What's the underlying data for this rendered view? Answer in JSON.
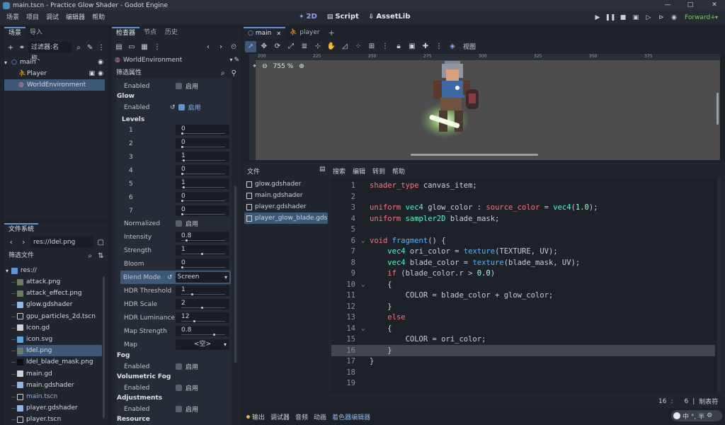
{
  "window": {
    "title": "main.tscn - Practice Glow Shader - Godot Engine",
    "minimize": "—",
    "maximize": "□",
    "close": "✕"
  },
  "menu": [
    "场景",
    "项目",
    "调试",
    "编辑器",
    "帮助"
  ],
  "workspaces": {
    "two_d": "2D",
    "script": "Script",
    "assetlib": "AssetLib"
  },
  "renderer": "Forward+",
  "scene_panel": {
    "tabs": [
      "场景",
      "导入"
    ],
    "filter_placeholder": "过滤器:名称、",
    "nodes": [
      {
        "label": "main",
        "level": 0
      },
      {
        "label": "Player",
        "level": 1
      },
      {
        "label": "WorldEnvironment",
        "level": 1,
        "selected": true
      }
    ]
  },
  "filesystem": {
    "title": "文件系统",
    "path": "res://Idel.png",
    "filter_placeholder": "筛选文件",
    "root": "res://",
    "files": [
      {
        "name": "attack.png",
        "icon": "image"
      },
      {
        "name": "attack_effect.png",
        "icon": "image"
      },
      {
        "name": "glow.gdshader",
        "icon": "shader"
      },
      {
        "name": "gpu_particles_2d.tscn",
        "icon": "scene"
      },
      {
        "name": "Icon.gd",
        "icon": "gear"
      },
      {
        "name": "icon.svg",
        "icon": "svg"
      },
      {
        "name": "Idel.png",
        "icon": "image",
        "selected": true
      },
      {
        "name": "Idel_blade_mask.png",
        "icon": "mask"
      },
      {
        "name": "main.gd",
        "icon": "gear"
      },
      {
        "name": "main.gdshader",
        "icon": "shader"
      },
      {
        "name": "main.tscn",
        "icon": "scene",
        "highlight": true
      },
      {
        "name": "player.gdshader",
        "icon": "shader"
      },
      {
        "name": "player.tscn",
        "icon": "scene"
      }
    ]
  },
  "inspector": {
    "tabs": [
      "检查器",
      "节点",
      "历史"
    ],
    "object": "WorldEnvironment",
    "filter_placeholder": "筛选属性",
    "enabled_label": "Enabled",
    "on_text": "启用",
    "glow_title": "Glow",
    "levels_title": "Levels",
    "levels": [
      {
        "label": "1",
        "value": "0"
      },
      {
        "label": "2",
        "value": "0"
      },
      {
        "label": "3",
        "value": "1"
      },
      {
        "label": "4",
        "value": "0"
      },
      {
        "label": "5",
        "value": "1"
      },
      {
        "label": "6",
        "value": "0"
      },
      {
        "label": "7",
        "value": "0"
      }
    ],
    "normalized_label": "Normalized",
    "props": [
      {
        "label": "Intensity",
        "value": "0.8",
        "fraction": 0.1
      },
      {
        "label": "Strength",
        "value": "1",
        "fraction": 0.5
      },
      {
        "label": "Bloom",
        "value": "0",
        "fraction": 0.0
      },
      {
        "label": "HDR Threshold",
        "value": "1",
        "fraction": 0.25
      },
      {
        "label": "HDR Scale",
        "value": "2",
        "fraction": 0.5
      },
      {
        "label": "HDR Luminance...",
        "value": "12",
        "fraction": 0.3
      },
      {
        "label": "Map Strength",
        "value": "0.8",
        "fraction": 0.8
      }
    ],
    "blend_mode_label": "Blend Mode",
    "blend_mode_value": "Screen",
    "map_label": "Map",
    "map_value": "<空>",
    "fog_title": "Fog",
    "volumetric_fog_title": "Volumetric Fog",
    "adjustments_title": "Adjustments",
    "resource_title": "Resource"
  },
  "editor_tabs": [
    {
      "label": "main",
      "active": true
    },
    {
      "label": "player",
      "active": false
    }
  ],
  "viewport": {
    "toolbar_view": "视图",
    "zoom": "755 %",
    "ruler": [
      "200",
      "225",
      "250",
      "275",
      "300",
      "325",
      "350",
      "375"
    ]
  },
  "script_panel": {
    "files_title": "文件",
    "menu": [
      "搜索",
      "编辑",
      "转到",
      "帮助"
    ],
    "files": [
      "glow.gdshader",
      "main.gdshader",
      "player.gdshader",
      "player_glow_blade.gds..."
    ],
    "selected_file": 3,
    "cursor_line": "16",
    "cursor_col": "6",
    "indent_mode": "制表符"
  },
  "code": [
    {
      "n": "1",
      "t": "shader_type canvas_item;"
    },
    {
      "n": "2",
      "t": ""
    },
    {
      "n": "3",
      "t": "uniform vec4 glow_color : source_color = vec4(1.0);"
    },
    {
      "n": "4",
      "t": "uniform sampler2D blade_mask;"
    },
    {
      "n": "5",
      "t": ""
    },
    {
      "n": "6",
      "t": "void fragment() {"
    },
    {
      "n": "7",
      "t": "    vec4 ori_color = texture(TEXTURE, UV);"
    },
    {
      "n": "8",
      "t": "    vec4 blade_color = texture(blade_mask, UV);"
    },
    {
      "n": "9",
      "t": "    if (blade_color.r > 0.0)"
    },
    {
      "n": "10",
      "t": "    {"
    },
    {
      "n": "11",
      "t": "        COLOR = blade_color + glow_color;"
    },
    {
      "n": "12",
      "t": "    }"
    },
    {
      "n": "13",
      "t": "    else"
    },
    {
      "n": "14",
      "t": "    {"
    },
    {
      "n": "15",
      "t": "        COLOR = ori_color;"
    },
    {
      "n": "16",
      "t": "    }"
    },
    {
      "n": "17",
      "t": "}"
    },
    {
      "n": "18",
      "t": ""
    },
    {
      "n": "19",
      "t": ""
    }
  ],
  "bottom_tabs": [
    "输出",
    "调试器",
    "音频",
    "动画",
    "着色器编辑器"
  ],
  "ime": "中 °, 半"
}
